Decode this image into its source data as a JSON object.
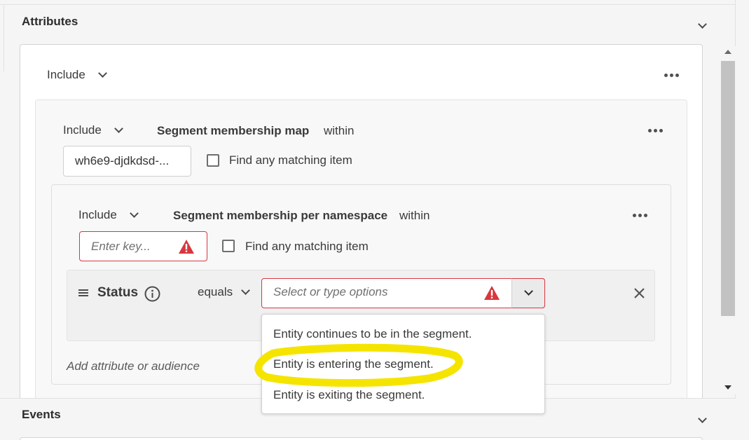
{
  "attributes": {
    "title": "Attributes",
    "include_label": "Include",
    "group": {
      "include_label": "Include",
      "field_name": "Segment membership map",
      "within_label": "within",
      "key_value": "wh6e9-djdkdsd-...",
      "find_any_label": "Find any matching item",
      "inner": {
        "include_label": "Include",
        "field_name": "Segment membership per namespace",
        "within_label": "within",
        "key_placeholder": "Enter key...",
        "find_any_label": "Find any matching item",
        "condition": {
          "field": "Status",
          "operator": "equals",
          "value_placeholder": "Select or type options",
          "options": [
            "Entity continues to be in the segment.",
            "Entity is entering the segment.",
            "Entity is exiting the segment."
          ],
          "highlighted_option": "Entity is entering the segment."
        },
        "add_link": "Add attribute or audience"
      }
    }
  },
  "events": {
    "title": "Events"
  },
  "colors": {
    "error": "#d7373f",
    "highlight": "#f5e400"
  },
  "icons": {
    "more": "more-dots-icon",
    "collapse": "chevron-down-icon",
    "warning": "alert-triangle-icon",
    "info": "info-icon",
    "drag": "drag-handle-icon",
    "remove": "close-icon"
  }
}
